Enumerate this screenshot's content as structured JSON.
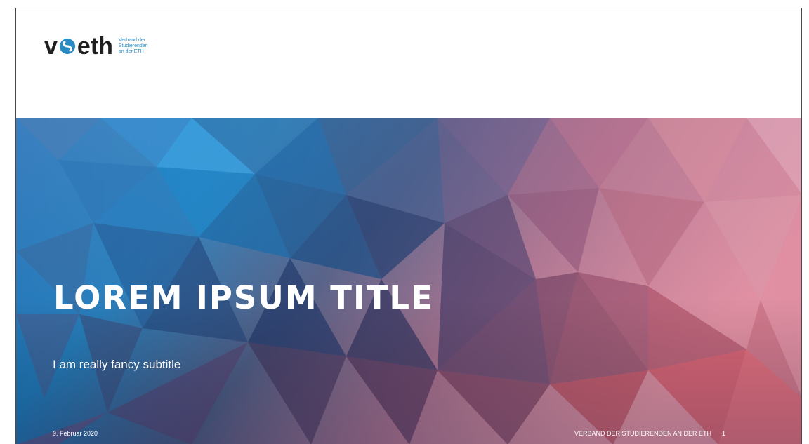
{
  "logo": {
    "wordmark_left": "v",
    "wordmark_right": "eth",
    "tagline_lines": [
      "Verband der",
      "Studierenden",
      "an der ETH"
    ]
  },
  "slide": {
    "title": "LOREM IPSUM TITLE",
    "subtitle": "I am really fancy subtitle",
    "footer_date": "9. Februar 2020",
    "footer_org": "VERBAND DER STUDIERENDEN AN DER ETH",
    "page_number": "1"
  },
  "colors": {
    "brand_blue": "#2a8bc4",
    "hero_blue": "#1b6fae",
    "hero_navy": "#2d3a66",
    "hero_red": "#d24a5a",
    "hero_pink": "#c98a9e"
  }
}
